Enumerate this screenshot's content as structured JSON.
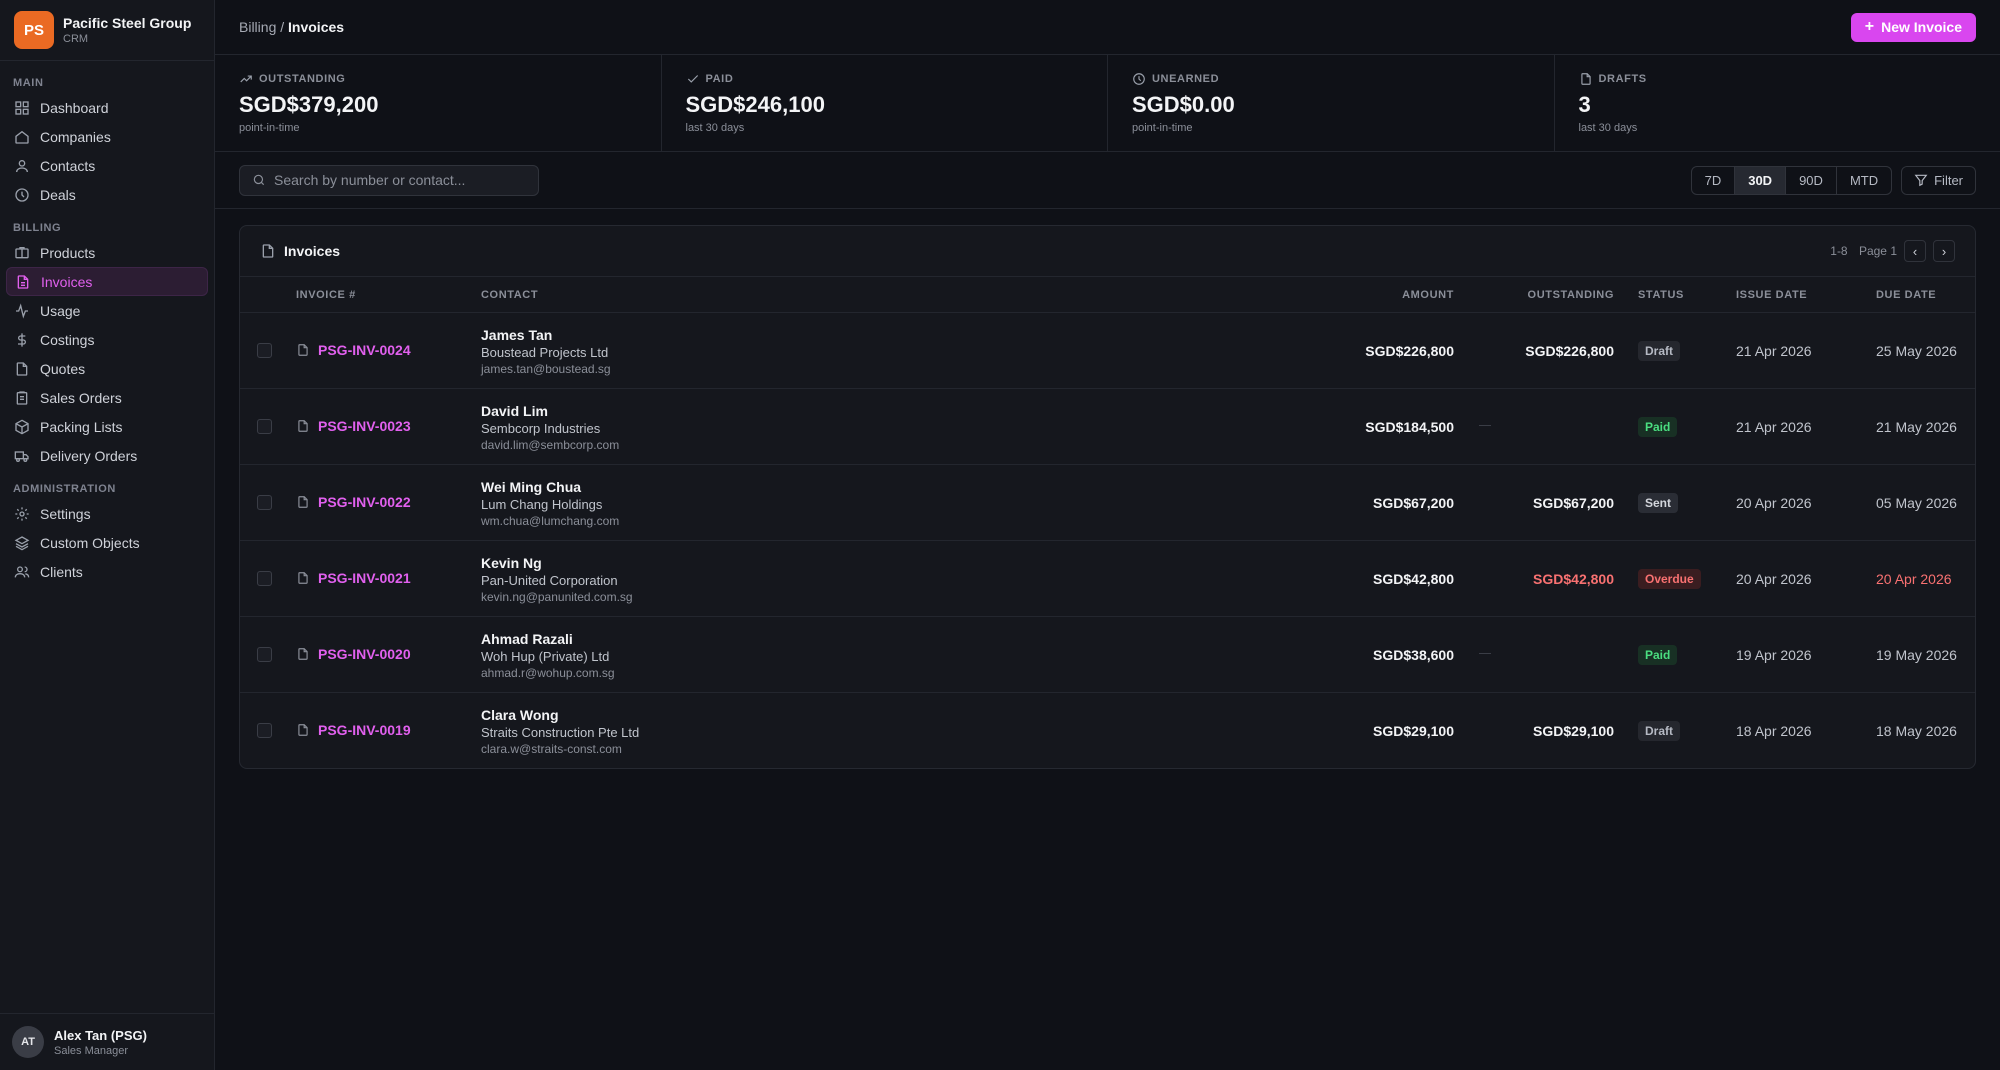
{
  "brand": {
    "initials": "PS",
    "name": "Pacific Steel Group",
    "sub": "CRM"
  },
  "nav": {
    "main_label": "MAIN",
    "main": [
      {
        "label": "Dashboard",
        "icon": "grid-icon"
      },
      {
        "label": "Companies",
        "icon": "home-icon"
      },
      {
        "label": "Contacts",
        "icon": "user-icon"
      },
      {
        "label": "Deals",
        "icon": "clock-icon"
      }
    ],
    "billing_label": "BILLING",
    "billing": [
      {
        "label": "Products",
        "icon": "package-icon"
      },
      {
        "label": "Invoices",
        "icon": "file-icon"
      },
      {
        "label": "Usage",
        "icon": "activity-icon"
      },
      {
        "label": "Costings",
        "icon": "dollar-icon"
      },
      {
        "label": "Quotes",
        "icon": "file-icon"
      },
      {
        "label": "Sales Orders",
        "icon": "clipboard-icon"
      },
      {
        "label": "Packing Lists",
        "icon": "box-icon"
      },
      {
        "label": "Delivery Orders",
        "icon": "truck-icon"
      }
    ],
    "admin_label": "ADMINISTRATION",
    "admin": [
      {
        "label": "Settings",
        "icon": "gear-icon"
      },
      {
        "label": "Custom Objects",
        "icon": "layers-icon"
      },
      {
        "label": "Clients",
        "icon": "users-icon"
      }
    ]
  },
  "user": {
    "initials": "AT",
    "name": "Alex Tan (PSG)",
    "role": "Sales Manager"
  },
  "header": {
    "crumb_parent": "Billing",
    "crumb_sep": " / ",
    "crumb_current": "Invoices",
    "new_button": "New Invoice"
  },
  "stats": [
    {
      "label": "OUTSTANDING",
      "value": "SGD$379,200",
      "sub": "point-in-time",
      "icon": "trending-up-icon"
    },
    {
      "label": "PAID",
      "value": "SGD$246,100",
      "sub": "last 30 days",
      "icon": "check-icon"
    },
    {
      "label": "UNEARNED",
      "value": "SGD$0.00",
      "sub": "point-in-time",
      "icon": "clock-icon"
    },
    {
      "label": "DRAFTS",
      "value": "3",
      "sub": "last 30 days",
      "icon": "file-icon"
    }
  ],
  "search": {
    "placeholder": "Search by number or contact..."
  },
  "ranges": [
    "7D",
    "30D",
    "90D",
    "MTD"
  ],
  "active_range": "30D",
  "filter_label": "Filter",
  "table": {
    "title": "Invoices",
    "range_text": "1-8",
    "page_text": "Page 1",
    "columns": {
      "invoice": "INVOICE #",
      "contact": "CONTACT",
      "amount": "AMOUNT",
      "outstanding": "OUTSTANDING",
      "status": "STATUS",
      "issue": "ISSUE DATE",
      "due": "DUE DATE"
    },
    "rows": [
      {
        "number": "PSG-INV-0024",
        "name": "James Tan",
        "company": "Boustead Projects Ltd",
        "email": "james.tan@boustead.sg",
        "amount": "SGD$226,800",
        "outstanding": "SGD$226,800",
        "status": "Draft",
        "issue": "21 Apr 2026",
        "due": "25 May 2026"
      },
      {
        "number": "PSG-INV-0023",
        "name": "David Lim",
        "company": "Sembcorp Industries",
        "email": "david.lim@sembcorp.com",
        "amount": "SGD$184,500",
        "outstanding": "",
        "status": "Paid",
        "issue": "21 Apr 2026",
        "due": "21 May 2026"
      },
      {
        "number": "PSG-INV-0022",
        "name": "Wei Ming Chua",
        "company": "Lum Chang Holdings",
        "email": "wm.chua@lumchang.com",
        "amount": "SGD$67,200",
        "outstanding": "SGD$67,200",
        "status": "Sent",
        "issue": "20 Apr 2026",
        "due": "05 May 2026"
      },
      {
        "number": "PSG-INV-0021",
        "name": "Kevin Ng",
        "company": "Pan-United Corporation",
        "email": "kevin.ng@panunited.com.sg",
        "amount": "SGD$42,800",
        "outstanding": "SGD$42,800",
        "status": "Overdue",
        "issue": "20 Apr 2026",
        "due": "20 Apr 2026"
      },
      {
        "number": "PSG-INV-0020",
        "name": "Ahmad Razali",
        "company": "Woh Hup (Private) Ltd",
        "email": "ahmad.r@wohup.com.sg",
        "amount": "SGD$38,600",
        "outstanding": "",
        "status": "Paid",
        "issue": "19 Apr 2026",
        "due": "19 May 2026"
      },
      {
        "number": "PSG-INV-0019",
        "name": "Clara Wong",
        "company": "Straits Construction Pte Ltd",
        "email": "clara.w@straits-const.com",
        "amount": "SGD$29,100",
        "outstanding": "SGD$29,100",
        "status": "Draft",
        "issue": "18 Apr 2026",
        "due": "18 May 2026"
      }
    ]
  }
}
